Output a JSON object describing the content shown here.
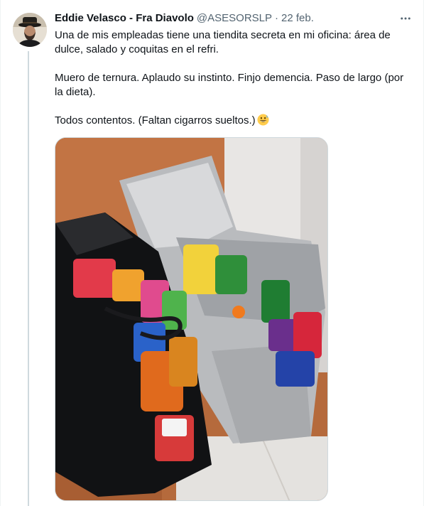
{
  "author": {
    "display_name": "Eddie Velasco - Fra Diavolo",
    "handle": "@ASESORSLP",
    "separator": "·",
    "date": "22 feb.",
    "avatar_icon": "avatar-man-hat"
  },
  "tweet": {
    "paragraphs": [
      "Una de mis empleadas tiene una tiendita secreta en mi oficina: área de dulce, salado y coquitas en el refri.",
      "Muero de ternura. Aplaudo su instinto. Finjo demencia. Paso de largo (por la dieta).",
      "Todos contentos. (Faltan cigarros sueltos.)"
    ],
    "trailing_emoji": "grinning-face-with-sweat-emoji"
  },
  "media": {
    "alt_icon": "photo-snack-bags",
    "description_icon": "photo"
  },
  "actions": {
    "more_icon": "more-icon"
  },
  "colors": {
    "text_primary": "#0f1419",
    "text_secondary": "#536471",
    "border": "#cfd9de",
    "thread_line": "#cfd9de"
  }
}
